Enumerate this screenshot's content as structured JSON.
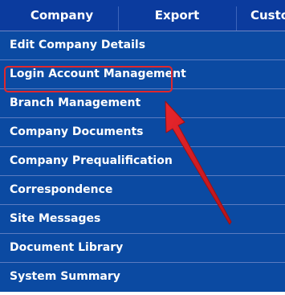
{
  "menubar": {
    "tabs": [
      {
        "label": "Company"
      },
      {
        "label": "Export"
      },
      {
        "label": "Custo"
      }
    ]
  },
  "dropdown": {
    "items": [
      {
        "label": "Edit Company Details"
      },
      {
        "label": "Login Account Management"
      },
      {
        "label": "Branch Management"
      },
      {
        "label": "Company Documents"
      },
      {
        "label": "Company Prequalification"
      },
      {
        "label": "Correspondence"
      },
      {
        "label": "Site Messages"
      },
      {
        "label": "Document Library"
      },
      {
        "label": "System Summary"
      }
    ]
  },
  "annotation": {
    "highlighted_item": "Login Account Management",
    "colors": {
      "highlight": "#e0282d",
      "menu_background": "#0b4aa2",
      "menubar_background": "#0b3b9e"
    }
  }
}
